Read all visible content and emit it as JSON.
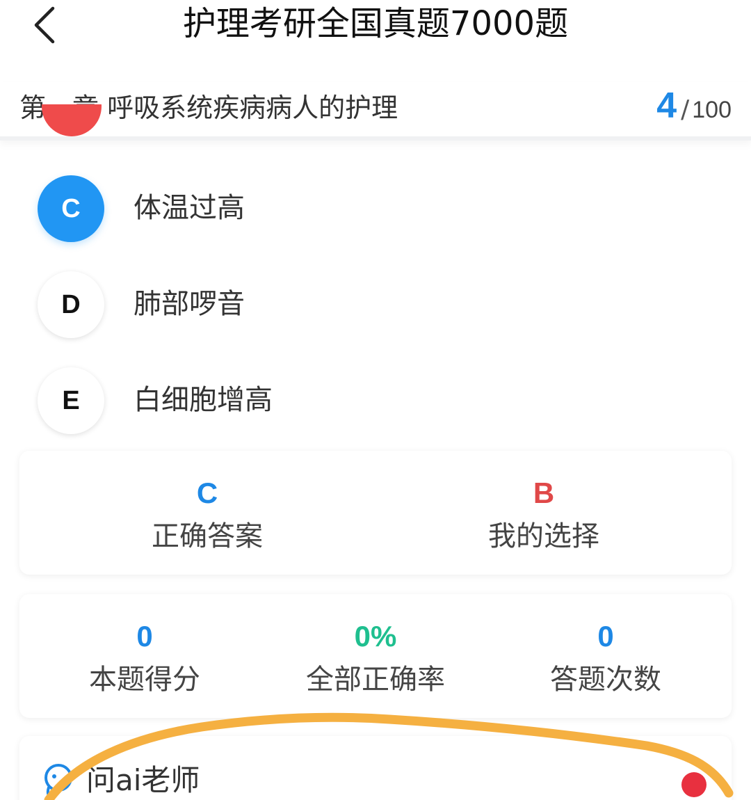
{
  "header": {
    "title": "护理考研全国真题7000题"
  },
  "chapter": {
    "title": "第一章 呼吸系统疾病病人的护理",
    "current": "4",
    "separator": "/",
    "total": "100"
  },
  "options": [
    {
      "letter": "C",
      "text": "体温过高",
      "state": "correct"
    },
    {
      "letter": "D",
      "text": "肺部啰音",
      "state": "normal"
    },
    {
      "letter": "E",
      "text": "白细胞增高",
      "state": "normal"
    }
  ],
  "answer": {
    "correct_value": "C",
    "correct_label": "正确答案",
    "mine_value": "B",
    "mine_label": "我的选择"
  },
  "stats": {
    "score_value": "0",
    "score_label": "本题得分",
    "accuracy_value": "0%",
    "accuracy_label": "全部正确率",
    "attempts_value": "0",
    "attempts_label": "答题次数"
  },
  "ai": {
    "label": "问ai老师",
    "icon": "ai-teacher-icon"
  },
  "colors": {
    "accent_blue": "#1e88e5",
    "option_correct": "#2196f3",
    "wrong_red": "#e04848",
    "accuracy_green": "#1fbf8f",
    "annotation_orange": "#f5b041"
  }
}
